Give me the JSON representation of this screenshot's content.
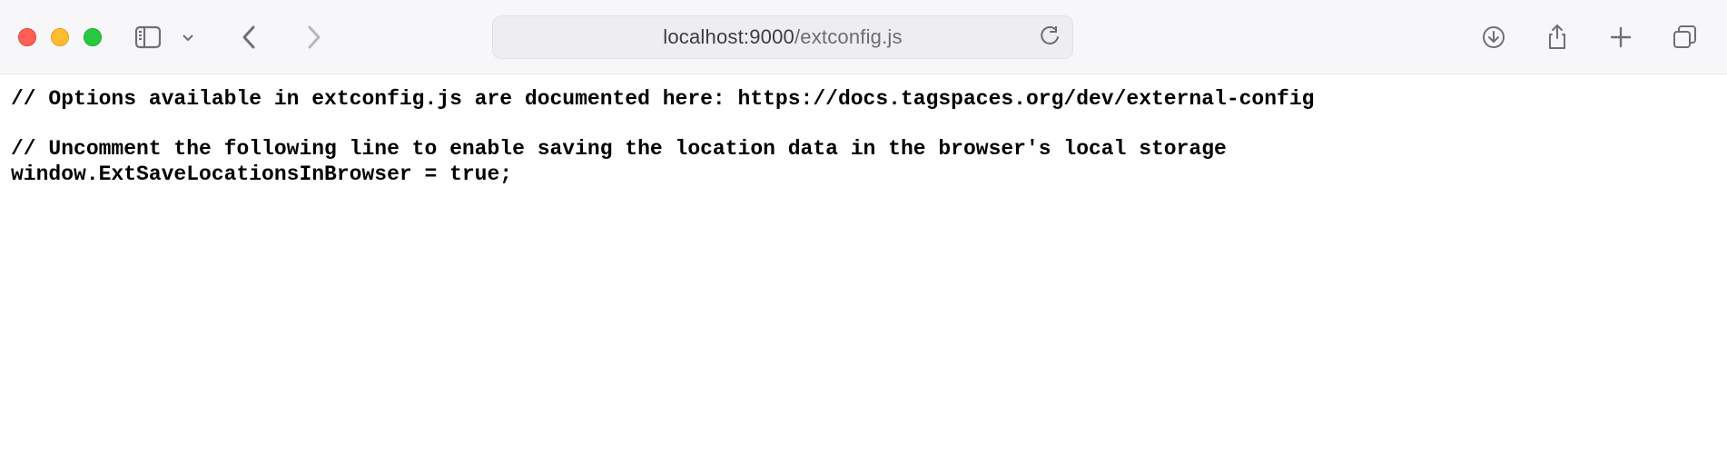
{
  "browser": {
    "url_host": "localhost:9000",
    "url_path": "/extconfig.js"
  },
  "code": {
    "line1": "// Options available in extconfig.js are documented here: https://docs.tagspaces.org/dev/external-config",
    "blank": "",
    "line2": "// Uncomment the following line to enable saving the location data in the browser's local storage",
    "line3": "window.ExtSaveLocationsInBrowser = true;"
  }
}
